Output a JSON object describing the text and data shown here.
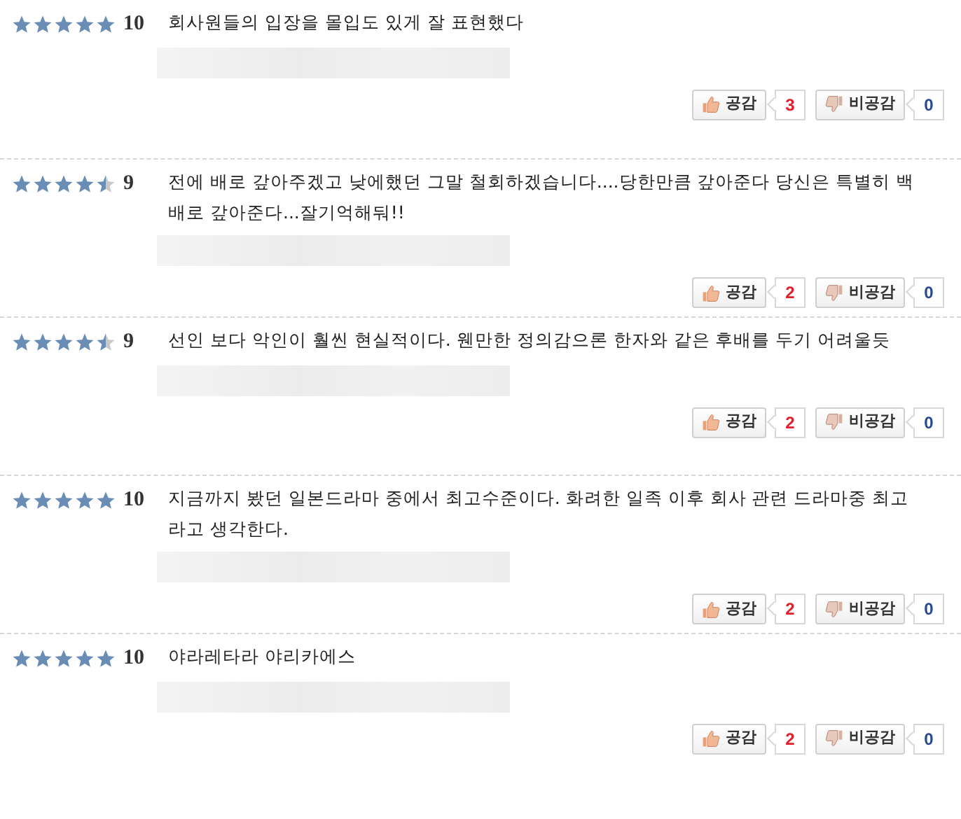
{
  "reviews": [
    {
      "stars": 5,
      "score": "10",
      "text": "회사원들의 입장을 몰입도 있게 잘 표현했다",
      "like": {
        "label": "공감",
        "count": "3"
      },
      "dislike": {
        "label": "비공감",
        "count": "0"
      }
    },
    {
      "stars": 4.5,
      "score": "9",
      "text": "전에 배로 갚아주겠고 낮에했던 그말 철회하겠습니다....당한만큼 갚아준다 당신은 특별히 백배로 갚아준다...잘기억해둬!!",
      "like": {
        "label": "공감",
        "count": "2"
      },
      "dislike": {
        "label": "비공감",
        "count": "0"
      }
    },
    {
      "stars": 4.5,
      "score": "9",
      "text": "선인 보다 악인이 훨씬 현실적이다. 웬만한 정의감으론 한자와 같은 후배를 두기 어려울듯",
      "like": {
        "label": "공감",
        "count": "2"
      },
      "dislike": {
        "label": "비공감",
        "count": "0"
      }
    },
    {
      "stars": 5,
      "score": "10",
      "text": "지금까지 봤던 일본드라마 중에서 최고수준이다. 화려한 일족 이후 회사 관련 드라마중 최고라고 생각한다.",
      "like": {
        "label": "공감",
        "count": "2"
      },
      "dislike": {
        "label": "비공감",
        "count": "0"
      }
    },
    {
      "stars": 5,
      "score": "10",
      "text": "야라레타라 야리카에스",
      "like": {
        "label": "공감",
        "count": "2"
      },
      "dislike": {
        "label": "비공감",
        "count": "0"
      }
    }
  ]
}
